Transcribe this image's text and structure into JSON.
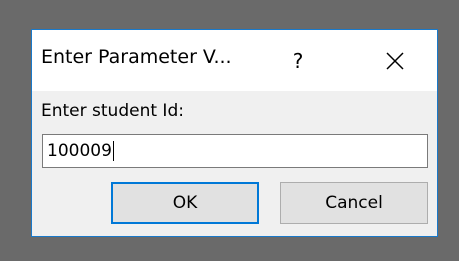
{
  "dialog": {
    "title": "Enter Parameter V...",
    "help_label": "?",
    "prompt": "Enter student Id:",
    "input_value": "100009",
    "ok_label": "OK",
    "cancel_label": "Cancel",
    "accent_color": "#0078d7",
    "icons": {
      "close": "close-icon"
    }
  }
}
